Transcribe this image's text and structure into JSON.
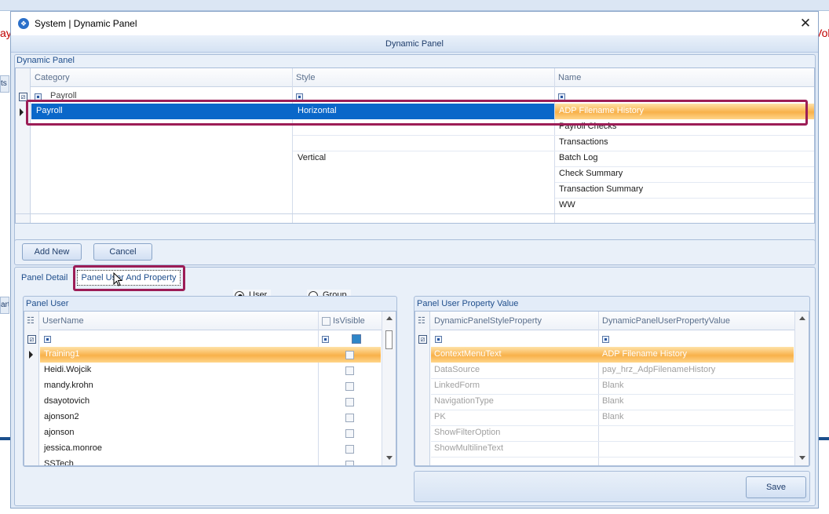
{
  "background": {
    "left_text": "ay",
    "right_text": "Vol",
    "left_tab_top": "ts",
    "left_tab_bottom": "artF"
  },
  "window": {
    "title": "System | Dynamic Panel",
    "close_glyph": "✕",
    "icon": "app-icon"
  },
  "header": {
    "title": "Dynamic Panel"
  },
  "dynamic_panel": {
    "caption": "Dynamic Panel",
    "columns": [
      "Category",
      "Style",
      "Name"
    ],
    "filter_category": "Payroll",
    "rows": [
      {
        "category": "Payroll",
        "style": "Horizontal",
        "name": "ADP Filename History",
        "selected": true
      },
      {
        "category": "",
        "style": "",
        "name": "Payroll Checks"
      },
      {
        "category": "",
        "style": "",
        "name": "Transactions"
      },
      {
        "category": "",
        "style": "Vertical",
        "name": "Batch Log"
      },
      {
        "category": "",
        "style": "",
        "name": "Check Summary"
      },
      {
        "category": "",
        "style": "",
        "name": "Transaction Summary"
      },
      {
        "category": "",
        "style": "",
        "name": "WW"
      }
    ],
    "buttons": {
      "add_new": "Add New",
      "cancel": "Cancel"
    }
  },
  "tabs": {
    "panel_detail": "Panel Detail",
    "panel_user_property": "Panel User And Property",
    "active": "panel_user_property"
  },
  "radio": {
    "user": "User",
    "group": "Group",
    "selected": "user"
  },
  "panel_user": {
    "caption": "Panel User",
    "columns": {
      "username": "UserName",
      "isvisible": "IsVisible"
    },
    "rows": [
      {
        "username": "Training1",
        "selected": true
      },
      {
        "username": "Heidi.Wojcik"
      },
      {
        "username": "mandy.krohn"
      },
      {
        "username": "dsayotovich"
      },
      {
        "username": "ajonson2"
      },
      {
        "username": "ajonson"
      },
      {
        "username": "jessica.monroe"
      },
      {
        "username": "SSTech"
      }
    ]
  },
  "property_value": {
    "caption": "Panel User Property Value",
    "columns": {
      "property": "DynamicPanelStyleProperty",
      "value": "DynamicPanelUserPropertyValue"
    },
    "rows": [
      {
        "property": "ContextMenuText",
        "value": "ADP Filename History",
        "selected": true
      },
      {
        "property": "DataSource",
        "value": "pay_hrz_AdpFilenameHistory"
      },
      {
        "property": "LinkedForm",
        "value": "Blank"
      },
      {
        "property": "NavigationType",
        "value": "Blank"
      },
      {
        "property": "PK",
        "value": "Blank"
      },
      {
        "property": "ShowFilterOption",
        "value": ""
      },
      {
        "property": "ShowMultilineText",
        "value": ""
      }
    ],
    "save": "Save"
  }
}
